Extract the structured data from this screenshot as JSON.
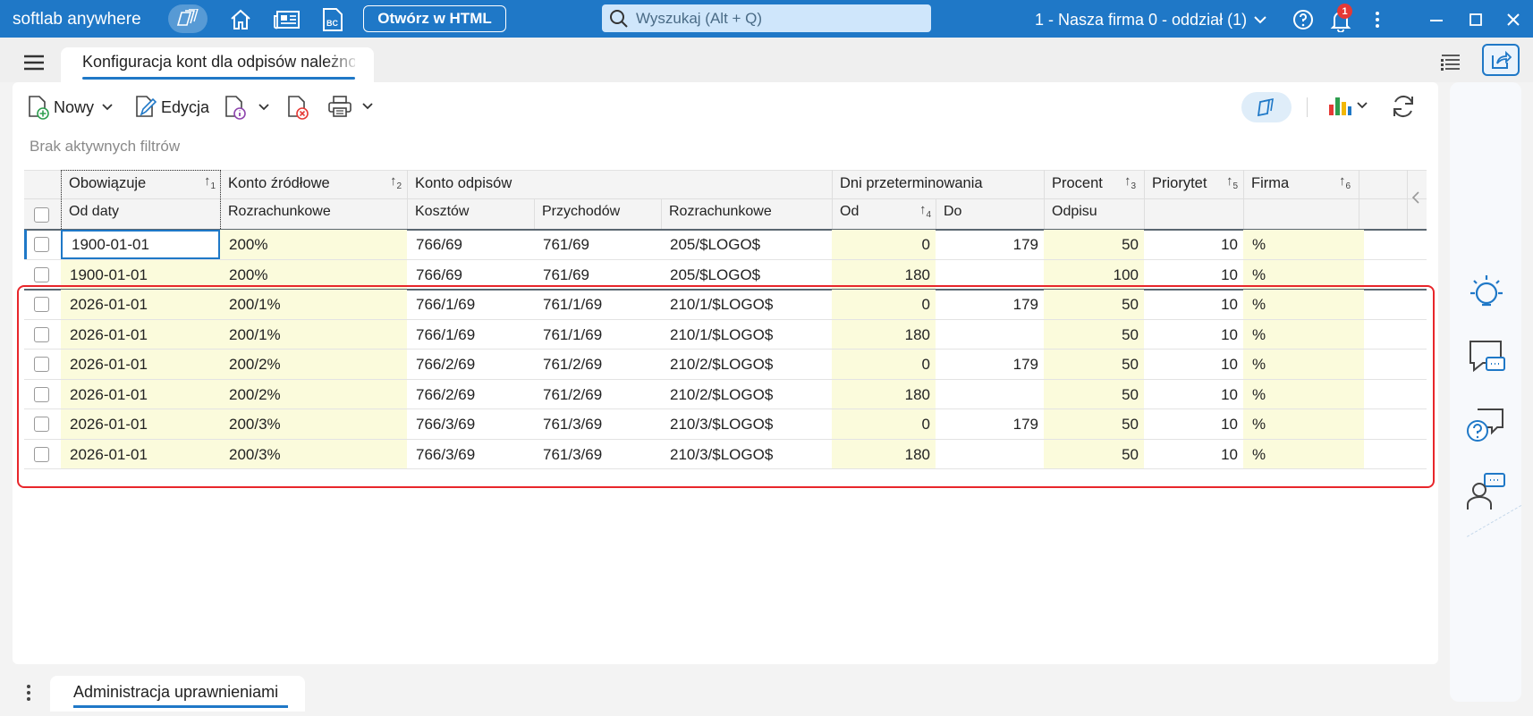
{
  "app": {
    "brand": "softlab anywhere",
    "open_html_label": "Otwórz w HTML",
    "search_placeholder": "Wyszukaj (Alt + Q)",
    "company": "1 - Nasza firma 0 - oddział (1)",
    "notification_count": "1",
    "accent_color": "#1f78c7"
  },
  "tabs": {
    "document_tab": "Konfiguracja kont dla odpisów należnośc",
    "bottom_tab": "Administracja uprawnieniami"
  },
  "toolbar": {
    "new_label": "Nowy",
    "edit_label": "Edycja"
  },
  "filters_text": "Brak aktywnych filtrów",
  "grid": {
    "group_headers": {
      "obowiazuje": "Obowiązuje",
      "konto_zrodlowe": "Konto źródłowe",
      "konto_odpisow": "Konto odpisów",
      "dni": "Dni przeterminowania",
      "procent": "Procent",
      "priorytet": "Priorytet",
      "firma": "Firma"
    },
    "sub_headers": {
      "od_daty": "Od daty",
      "rozrachunkowe1": "Rozrachunkowe",
      "kosztow": "Kosztów",
      "przychodow": "Przychodów",
      "rozrachunkowe2": "Rozrachunkowe",
      "od": "Od",
      "do": "Do",
      "odpisu": "Odpisu"
    },
    "sort_indices": [
      "1",
      "2",
      "3",
      "4",
      "5",
      "6"
    ],
    "rows": [
      {
        "date": "1900-01-01",
        "src": "200%",
        "cost": "766/69",
        "income": "761/69",
        "settle": "205/$LOGO$",
        "from": "0",
        "to": "179",
        "pct": "50",
        "prio": "10",
        "firma": "%"
      },
      {
        "date": "1900-01-01",
        "src": "200%",
        "cost": "766/69",
        "income": "761/69",
        "settle": "205/$LOGO$",
        "from": "180",
        "to": "",
        "pct": "100",
        "prio": "10",
        "firma": "%"
      },
      {
        "date": "2026-01-01",
        "src": "200/1%",
        "cost": "766/1/69",
        "income": "761/1/69",
        "settle": "210/1/$LOGO$",
        "from": "0",
        "to": "179",
        "pct": "50",
        "prio": "10",
        "firma": "%"
      },
      {
        "date": "2026-01-01",
        "src": "200/1%",
        "cost": "766/1/69",
        "income": "761/1/69",
        "settle": "210/1/$LOGO$",
        "from": "180",
        "to": "",
        "pct": "50",
        "prio": "10",
        "firma": "%"
      },
      {
        "date": "2026-01-01",
        "src": "200/2%",
        "cost": "766/2/69",
        "income": "761/2/69",
        "settle": "210/2/$LOGO$",
        "from": "0",
        "to": "179",
        "pct": "50",
        "prio": "10",
        "firma": "%"
      },
      {
        "date": "2026-01-01",
        "src": "200/2%",
        "cost": "766/2/69",
        "income": "761/2/69",
        "settle": "210/2/$LOGO$",
        "from": "180",
        "to": "",
        "pct": "50",
        "prio": "10",
        "firma": "%"
      },
      {
        "date": "2026-01-01",
        "src": "200/3%",
        "cost": "766/3/69",
        "income": "761/3/69",
        "settle": "210/3/$LOGO$",
        "from": "0",
        "to": "179",
        "pct": "50",
        "prio": "10",
        "firma": "%"
      },
      {
        "date": "2026-01-01",
        "src": "200/3%",
        "cost": "766/3/69",
        "income": "761/3/69",
        "settle": "210/3/$LOGO$",
        "from": "180",
        "to": "",
        "pct": "50",
        "prio": "10",
        "firma": "%"
      }
    ]
  }
}
